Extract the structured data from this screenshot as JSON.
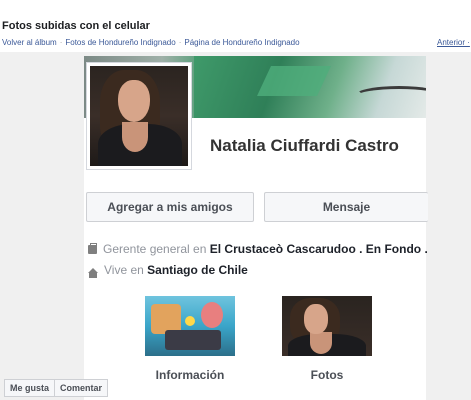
{
  "album": {
    "title": "Fotos subidas con el celular",
    "breadcrumb": [
      "Volver al álbum",
      "Fotos de Hondureño Indignado",
      "Página de Hondureño Indignado"
    ],
    "prev_link": "Anterior ·"
  },
  "profile": {
    "name": "Natalia Ciuffardi Castro",
    "add_friend_label": "Agregar a mis amigos",
    "message_label": "Mensaje",
    "work_prefix": "Gerente general en",
    "work_place": "El Crustaceò Cascarudoo . En Fondo .",
    "home_prefix": "Vive en",
    "home_place": "Santiago de Chile",
    "tiles": [
      {
        "label": "Información",
        "icon": "info-thumbnail"
      },
      {
        "label": "Fotos",
        "icon": "photos-thumbnail"
      }
    ]
  },
  "actions": {
    "like_label": "Me gusta",
    "comment_label": "Comentar"
  },
  "icons": {
    "work": "briefcase-icon",
    "home": "house-icon"
  },
  "colors": {
    "link": "#3b5998",
    "button_bg": "#f6f7f9",
    "muted_text": "#90949c"
  }
}
